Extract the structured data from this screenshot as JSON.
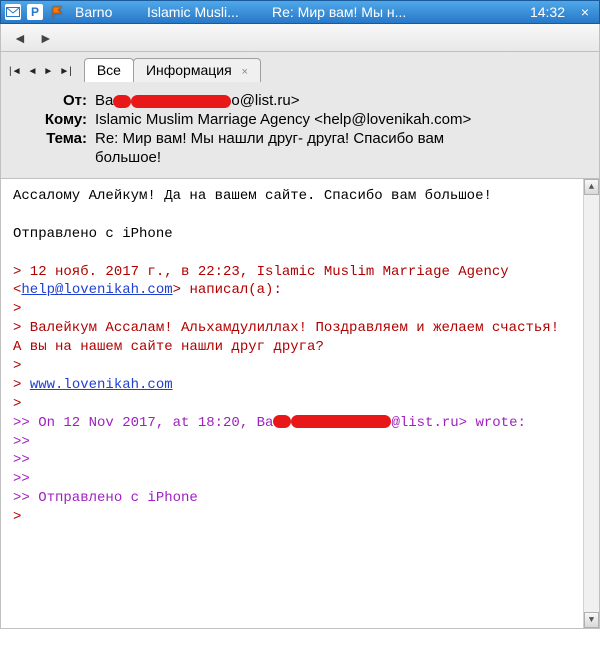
{
  "titlebar": {
    "p_badge": "P",
    "from": "Barno",
    "subject_short": "Islamic Musli...",
    "re_short": "Re: Мир вам! Мы н...",
    "time": "14:32",
    "close": "×"
  },
  "navbar": {
    "back": "◄",
    "forward": "►"
  },
  "pager": {
    "first": "|◄",
    "prev": "◄",
    "next": "►",
    "last": "►|"
  },
  "tabs": {
    "all": "Все",
    "info": "Информация"
  },
  "header": {
    "from_label": "От:",
    "from_prefix": "Ba",
    "from_suffix": "o@list.ru>",
    "to_label": "Кому:",
    "to_value": "Islamic Muslim Marriage Agency <help@lovenikah.com>",
    "subject_label": "Тема:",
    "subject_value_1": "Re: Мир вам! Мы нашли друг- друга! Спасибо вам",
    "subject_value_2": "большое!"
  },
  "body": {
    "l1": "Ассалому Алейкум! Да на вашем сайте. Спасибо вам большое!",
    "blank": " ",
    "l2": "Отправлено с iPhone",
    "q1a_pre": "> 12 нояб. 2017 г., в 22:23, Islamic Muslim Marriage Agency <",
    "q1a_link": "help@lovenikah.com",
    "q1a_suf": "> написал(а):",
    "gt1": ">",
    "q1b": "> Валейкум Ассалам! Альхамдулиллах! Поздравляем и желаем счастья!  А вы на нашем сайте нашли друг друга?",
    "q1c_pre": "> ",
    "q1c_link": "www.lovenikah.com",
    "q2a_pre": ">> On 12 Nov 2017, at 18:20, Ba",
    "q2a_suf": "@list.ru> wrote:",
    "gt2": ">>",
    "q2b": ">> Отправлено с iPhone"
  }
}
